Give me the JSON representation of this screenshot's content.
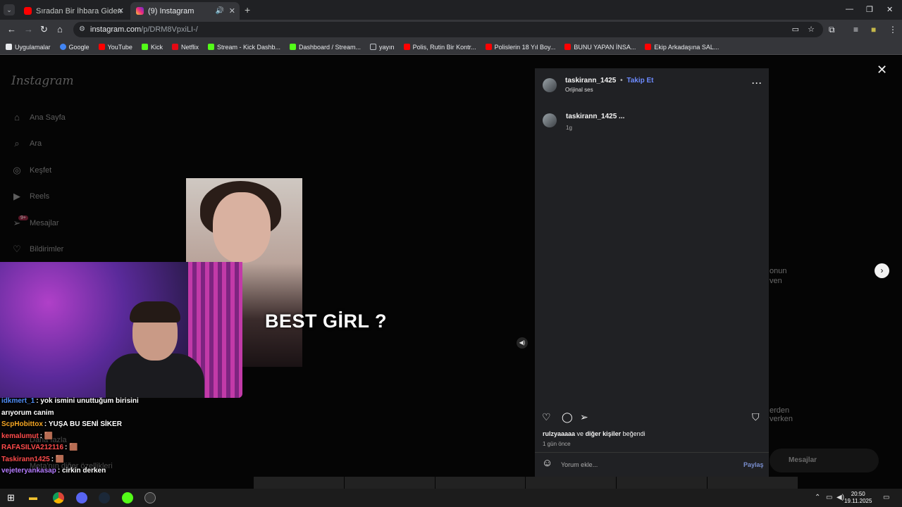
{
  "tabs": [
    {
      "title": "Sıradan Bir İhbara Giden Polisler",
      "close": "✕"
    },
    {
      "title": "(9) Instagram",
      "close": "✕"
    }
  ],
  "newtab": "+",
  "tabmenu": "⌄",
  "window": {
    "minimize": "—",
    "restore": "❐",
    "close": "✕"
  },
  "address": {
    "host": "instagram.com",
    "path": "/p/DRM8VpxiLI-/"
  },
  "bookmarks": [
    {
      "label": "Uygulamalar",
      "color": "#e8eaed"
    },
    {
      "label": "Google",
      "color": "#4285f4"
    },
    {
      "label": "YouTube",
      "color": "#ff0000"
    },
    {
      "label": "Kick",
      "color": "#53fc18"
    },
    {
      "label": "Netflix",
      "color": "#e50914"
    },
    {
      "label": "Stream - Kick Dashb...",
      "color": "#53fc18"
    },
    {
      "label": "Dashboard / Stream...",
      "color": "#53fc18"
    },
    {
      "label": "yayın",
      "color": "#bdc1c6"
    },
    {
      "label": "Polis, Rutin Bir Kontr...",
      "color": "#ff0000"
    },
    {
      "label": "Polislerin 18 Yıl Boy...",
      "color": "#ff0000"
    },
    {
      "label": "BUNU YAPAN İNSA...",
      "color": "#ff0000"
    },
    {
      "label": "Ekip Arkadaşına SAL...",
      "color": "#ff0000"
    }
  ],
  "sidebar": {
    "logo": "Instagram",
    "items": [
      {
        "label": "Ana Sayfa",
        "icon": "⌂"
      },
      {
        "label": "Ara",
        "icon": "⌕"
      },
      {
        "label": "Keşfet",
        "icon": "◎"
      },
      {
        "label": "Reels",
        "icon": "▶"
      },
      {
        "label": "Mesajlar",
        "icon": "➢"
      },
      {
        "label": "Bildirimler",
        "icon": "♡"
      }
    ],
    "badge": "9+",
    "more": "Daha fazla",
    "meta": "Meta'nın diğer özellikleri"
  },
  "reel": {
    "caption": "BEST GİRL ?",
    "mute_icon": "◀)"
  },
  "chat": [
    {
      "user": "idkmert_1",
      "color": "#4f8ef7",
      "msg": ": yok ismini unuttuğum birisini arıyorum canim"
    },
    {
      "user": "ScpHobittox",
      "color": "#f5a623",
      "msg": ": YUŞA BU SENİ SİKER"
    },
    {
      "user": "kemalumut",
      "color": "#ff4b4b",
      "msg": ": 🟫"
    },
    {
      "user": "RAFASILVA212116",
      "color": "#ff4b4b",
      "msg": ": 🟫"
    },
    {
      "user": "Taskirann1425",
      "color": "#ff4b4b",
      "msg": ": 🟫"
    },
    {
      "user": "vejeteryankasap",
      "color": "#b57cff",
      "msg": ": cirkin derken"
    }
  ],
  "post": {
    "username": "taskirann_1425",
    "follow": "Takip Et",
    "dot": "•",
    "audio": "Orijinal ses",
    "more": "···",
    "caption_user": "taskirann_1425 ...",
    "caption_time": "1g",
    "likes_user": "rulzyaaaaa",
    "likes_rest": " ve ",
    "likes_others": "diğer kişiler",
    "likes_suffix": " beğendi",
    "ago": "1 gün önce",
    "comment_placeholder": "Yorum ekle...",
    "post_button": "Paylaş"
  },
  "side_ghost": {
    "a": "onun",
    "b": "ven",
    "c": "erden",
    "d": "verken"
  },
  "messages_pill": "Mesajlar",
  "clock": {
    "time": "20:50",
    "date": "19.11.2025"
  }
}
